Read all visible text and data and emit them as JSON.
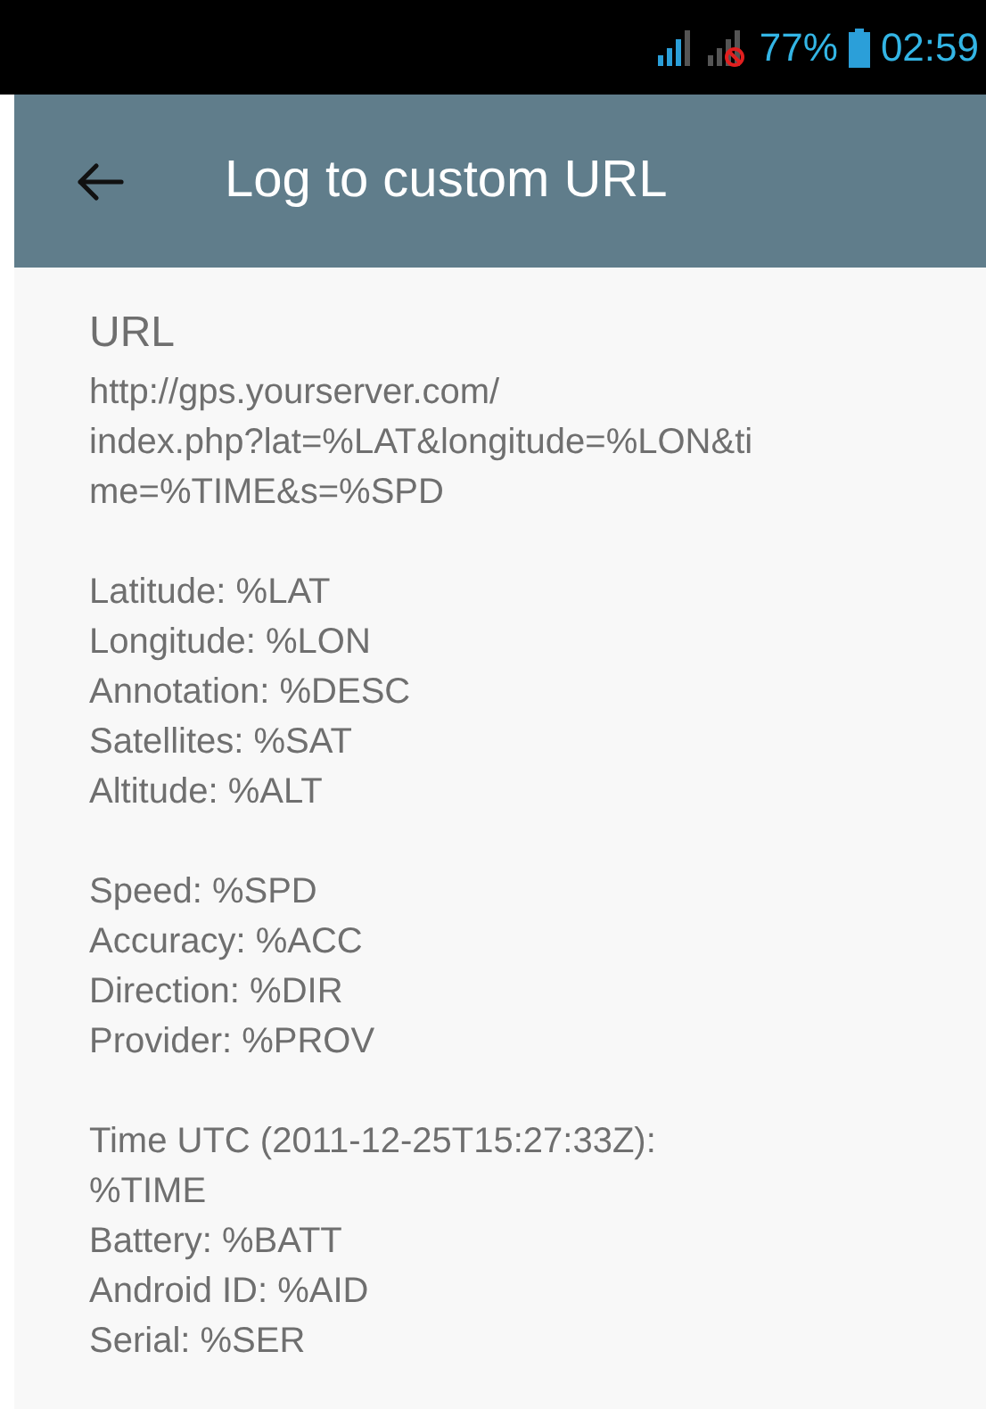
{
  "status_bar": {
    "battery": "77%",
    "time": "02:59"
  },
  "toolbar": {
    "title": "Log to custom URL"
  },
  "content": {
    "heading": "URL",
    "groups": [
      [
        "http://gps.yourserver.com/",
        "index.php?lat=%LAT&longitude=%LON&ti",
        "me=%TIME&s=%SPD"
      ],
      [
        "Latitude: %LAT",
        "Longitude: %LON",
        "Annotation: %DESC",
        "Satellites: %SAT",
        "Altitude: %ALT"
      ],
      [
        "Speed: %SPD",
        "Accuracy: %ACC",
        "Direction: %DIR",
        "Provider: %PROV"
      ],
      [
        "Time UTC (2011-12-25T15:27:33Z):",
        "%TIME",
        "Battery: %BATT",
        "Android ID: %AID",
        "Serial: %SER"
      ]
    ]
  }
}
